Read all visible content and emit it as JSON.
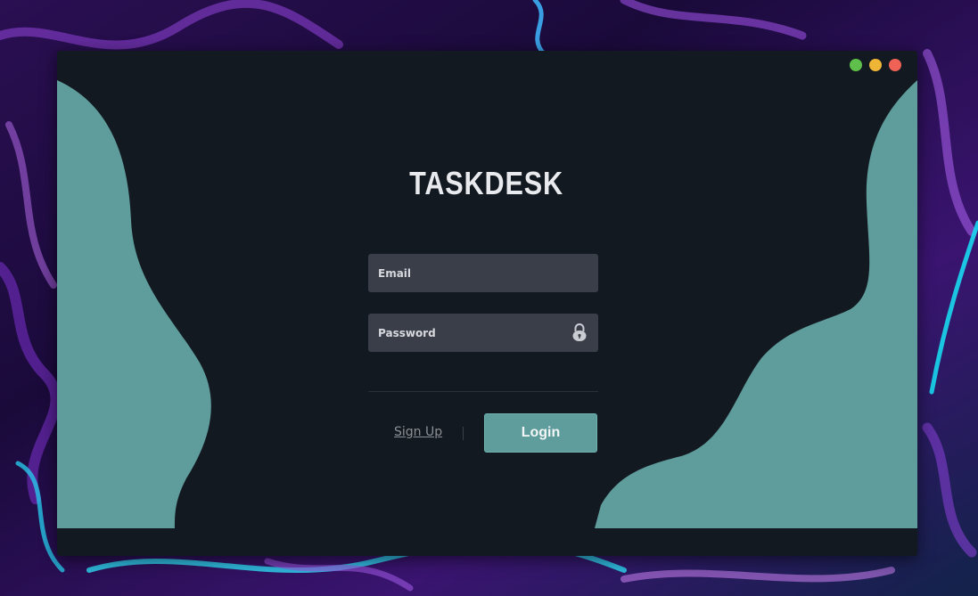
{
  "app": {
    "logo_text": "TASKDESK"
  },
  "form": {
    "email_placeholder": "Email",
    "email_value": "",
    "password_placeholder": "Password",
    "password_value": "",
    "signup_label": "Sign Up",
    "login_label": "Login"
  },
  "icons": {
    "password_field": "lock-icon",
    "window_controls": [
      "maximize-dot",
      "minimize-dot",
      "close-dot"
    ]
  },
  "colors": {
    "window_bg": "#131920",
    "accent_teal": "#5f9c9c",
    "input_bg": "#3a3e48",
    "control_green": "#5ec04a",
    "control_yellow": "#efb536",
    "control_red": "#ee6356"
  }
}
